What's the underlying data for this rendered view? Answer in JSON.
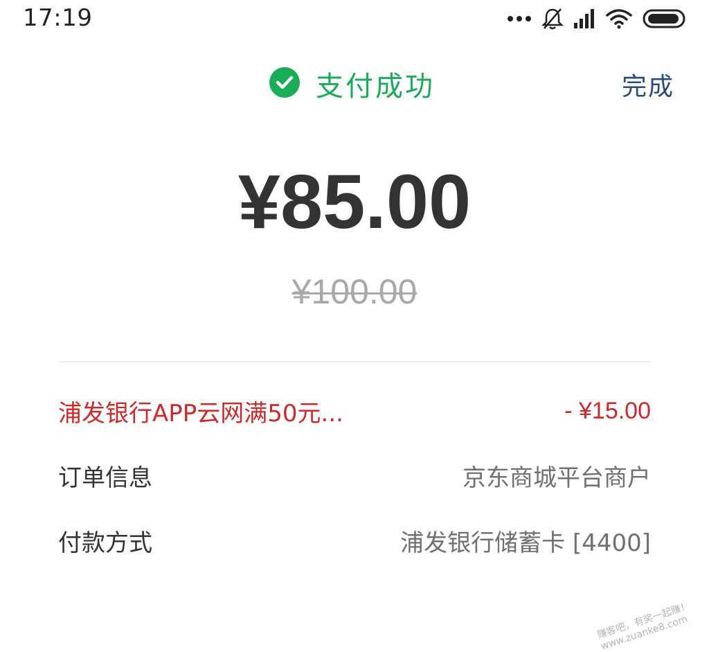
{
  "status_bar": {
    "time": "17:19",
    "icons": [
      "more-dots-icon",
      "bell-muted-icon",
      "signal-icon",
      "wifi-icon",
      "battery-icon"
    ]
  },
  "header": {
    "title": "支付成功",
    "done_label": "完成",
    "success_color": "#1aad58",
    "done_color": "#2a4a7b"
  },
  "payment": {
    "amount": "¥85.00",
    "original_amount": "¥100.00"
  },
  "details": {
    "discount": {
      "label": "浦发银行APP云网满50元...",
      "value": "- ¥15.00",
      "color": "#cc2a2a"
    },
    "order": {
      "label": "订单信息",
      "value": "京东商城平台商户"
    },
    "payment_method": {
      "label": "付款方式",
      "value": "浦发银行储蓄卡 [4400]"
    }
  },
  "watermark": {
    "line1": "赚客吧，有奖一起赚！",
    "line2": "www.zuanke8.com"
  }
}
